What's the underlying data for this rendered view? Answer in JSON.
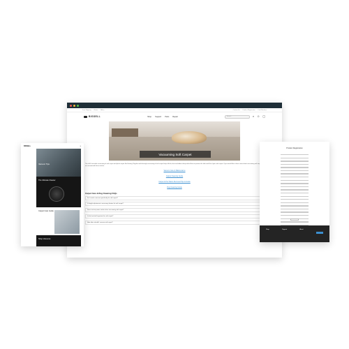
{
  "topbar": {
    "left_items": [
      "Free Shipping",
      "Klarna",
      "Affirm"
    ],
    "right_items": [
      "Contact Us",
      "Product Registration",
      "Find Retailers"
    ]
  },
  "nav": {
    "brand": "BISSELL",
    "links": [
      "Shop",
      "Support",
      "Parts",
      "Repair"
    ],
    "search_placeholder": "Search",
    "icons": [
      "search-icon",
      "user-icon",
      "cart-icon"
    ]
  },
  "hero": {
    "caption": "Vacuuming Soft Carpet"
  },
  "intro": "The full & versatile vacuuming of soft carpet and plush carpet like flooring. Regular and thorough vacuuming of soft carpet helps lift dirt, dust and debris deep within fibers to protect the look and life of your soft carpet. If you would like to learn more about vacuuming soft carpet, we recommend these articles:",
  "article_links": [
    "Vacuum Care & Maintenance",
    "Carpet Cleaning Guide",
    "Carpet & Pet Stains Removal Tips & Guide",
    "Rug Cleaning Guide"
  ],
  "faq": {
    "title": "Carpet Care & Rug Cleaning FAQs",
    "items": [
      "Do I need a vacuum specifically for soft carpet?",
      "Is height adjustment a necessary feature for soft carpet?",
      "Does suction power matter when vacuuming soft carpet?",
      "Is the brushroll important for soft carpet?",
      "How often should I vacuum soft carpet?"
    ]
  },
  "phone_left": {
    "brand": "BISSELL",
    "hero_text": "Vacuum Tips",
    "dark_text": "The Ultimate Cleaner",
    "light_text": "Carpet Care Guide",
    "foot_text": "Shop Vacuums"
  },
  "phone_right": {
    "title": "Product Registration",
    "footer_cols": [
      "Shop",
      "Support",
      "About"
    ]
  },
  "colors": {
    "chrome": "#1f2f38",
    "link": "#3b8fd0",
    "dot_red": "#ee5b52",
    "dot_yellow": "#f2bb3c",
    "dot_green": "#59c24a"
  }
}
